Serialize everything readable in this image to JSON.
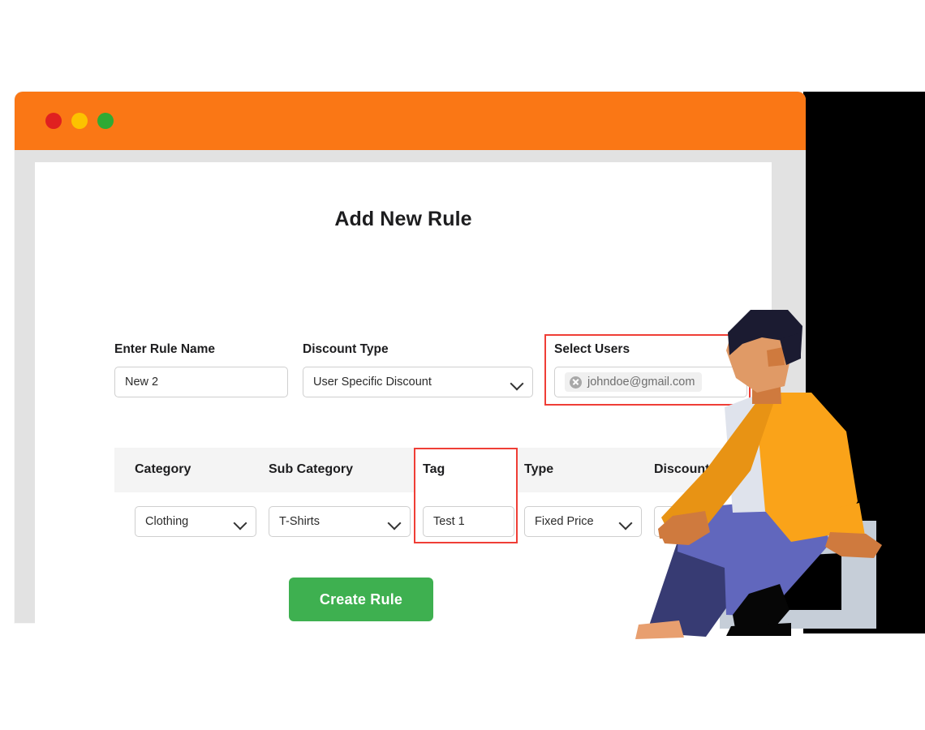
{
  "window": {
    "titlebar_dots": [
      "close-dot",
      "minimize-dot",
      "maximize-dot"
    ],
    "colors": {
      "titlebar": "#fa7715",
      "frame": "#e2e2e2",
      "dot_red": "#e02020",
      "dot_yellow": "#fcc200",
      "dot_green": "#2faa34",
      "accent_green": "#3eb050",
      "accent_red": "#ef4b52",
      "highlight_red": "#ef3e36"
    }
  },
  "page": {
    "title": "Add New Rule"
  },
  "form": {
    "rule_name": {
      "label": "Enter Rule Name",
      "value": "New 2",
      "placeholder": "Enter Rule Name"
    },
    "discount_type": {
      "label": "Discount Type",
      "value": "User Specific Discount",
      "options": [
        "User Specific Discount"
      ],
      "chevron": "chevron-down-icon"
    },
    "select_users": {
      "label": "Select Users",
      "highlighted": true,
      "chips": [
        {
          "text": "johndoe@gmail.com",
          "remove_icon": "close-circle-icon"
        }
      ]
    }
  },
  "rules_table": {
    "headers": {
      "category": "Category",
      "sub_category": "Sub Category",
      "tag": "Tag",
      "type": "Type",
      "discount": "Discount"
    },
    "add_row_icon": "plus-icon",
    "remove_row_icon": "minus-icon",
    "tag_column_highlighted": true,
    "rows": [
      {
        "category": "Clothing",
        "sub_category": "T-Shirts",
        "tag": "Test 1",
        "type": "Fixed Price",
        "discount": ""
      }
    ]
  },
  "actions": {
    "create_rule": "Create Rule"
  }
}
